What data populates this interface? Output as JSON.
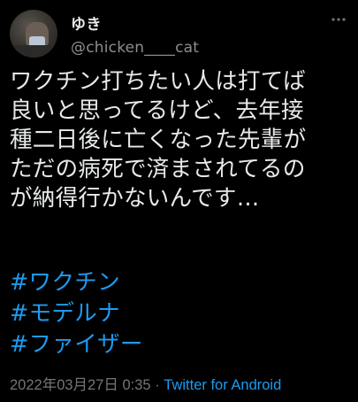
{
  "user": {
    "display_name": "ゆき",
    "handle": "@chicken____cat"
  },
  "more_icon": "more-horizontal-icon",
  "tweet": {
    "text": "ワクチン打ちたい人は打てば\n良いと思ってるけど、去年接\n種二日後に亡くなった先輩が\nただの病死で済まされてるの\nが納得行かないんです…",
    "hashtags": [
      "#ワクチン",
      "#モデルナ",
      "#ファイザー"
    ],
    "timestamp": "2022年03月27日 0:35",
    "separator": " · ",
    "source": "Twitter for Android"
  },
  "colors": {
    "background": "#000000",
    "text": "#e7e9ea",
    "secondary": "#71767b",
    "link": "#1d9bf0"
  }
}
